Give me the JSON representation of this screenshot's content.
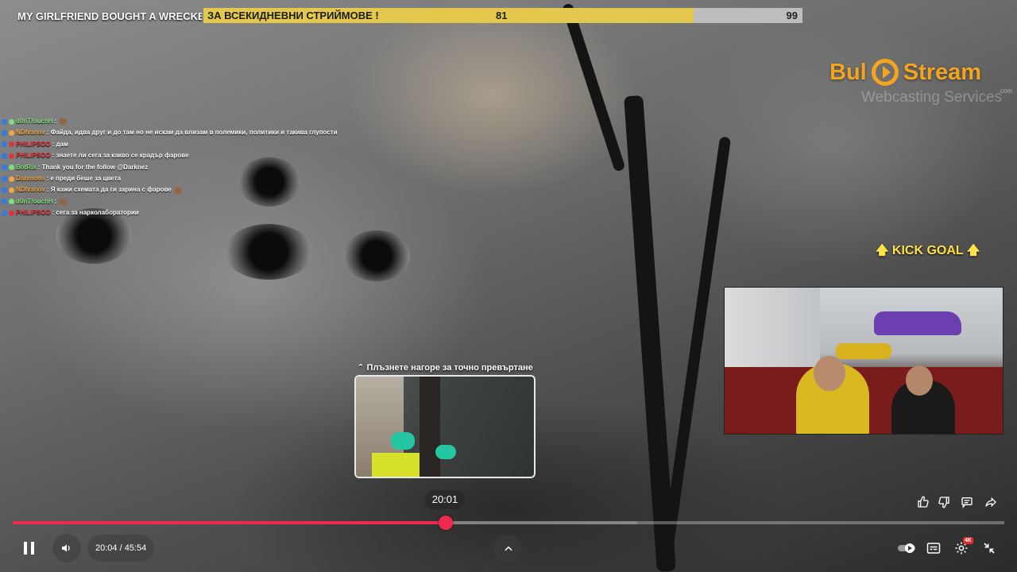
{
  "video": {
    "title": "MY GIRLFRIEND BOUGHT A WRECKED LA"
  },
  "goal": {
    "label": "ЗА ВСЕКИДНЕВНИ СТРИЙМОВЕ !",
    "current": "81",
    "target": "99",
    "fill_color": "#e4c84e",
    "progress": 0.818
  },
  "logo": {
    "name_left": "Bul",
    "name_right": "Stream",
    "tagline": "Webcasting Services",
    "domain": ".com",
    "color": "#f4a51f"
  },
  "kick_goal": {
    "label": "KICK GOAL",
    "icon": "arrow-up-icon"
  },
  "chat": [
    {
      "user": "d0nT!ouchH",
      "color": "#7ee07a",
      "message": ":",
      "emote": true
    },
    {
      "user": "NDIvanov",
      "color": "#f2a63b",
      "message": ": Файда, идва друг и до там но не искам да влизам в полемики, политики и такива глупости",
      "emote": false
    },
    {
      "user": "PHILIPSOO",
      "color": "#e2323c",
      "message": ": дам",
      "emote": false
    },
    {
      "user": "PHILIPSOO",
      "color": "#e2323c",
      "message": ": знаете ли сега за какво се крадър фарове",
      "emote": false
    },
    {
      "user": "BotRix",
      "color": "#7ee07a",
      "message": ": Thank you for the follow @Darknez",
      "emote": false
    },
    {
      "user": "Danmons",
      "color": "#f2a63b",
      "message": ": е преди беше за цвета",
      "emote": false
    },
    {
      "user": "NDIvanov",
      "color": "#f2a63b",
      "message": ": Я кажи схемата да ги зарина с фарове",
      "emote": true
    },
    {
      "user": "d0nT!ouchH",
      "color": "#7ee07a",
      "message": ":",
      "emote": true
    },
    {
      "user": "PHILIPSOO",
      "color": "#e2323c",
      "message": ": сега за нарколаборатории",
      "emote": false
    }
  ],
  "seek_preview": {
    "hint": "Плъзнете нагоре за точно превъртане",
    "time": "20:01"
  },
  "player": {
    "current_time": "20:04",
    "duration": "45:54",
    "time_label": "20:04 / 45:54",
    "played_fraction": 0.437,
    "buffered_fraction": 0.63,
    "accent_color": "#f02a4e",
    "quality_badge": "4K"
  },
  "icons": {
    "pause": "pause-icon",
    "volume": "volume-icon",
    "chevron_up": "chevron-up-icon",
    "like": "thumbs-up-icon",
    "dislike": "thumbs-down-icon",
    "comments": "comment-icon",
    "share": "share-icon",
    "autoplay": "autoplay-toggle-icon",
    "subtitles": "subtitles-icon",
    "settings": "gear-icon",
    "exit_fullscreen": "exit-fullscreen-icon"
  }
}
